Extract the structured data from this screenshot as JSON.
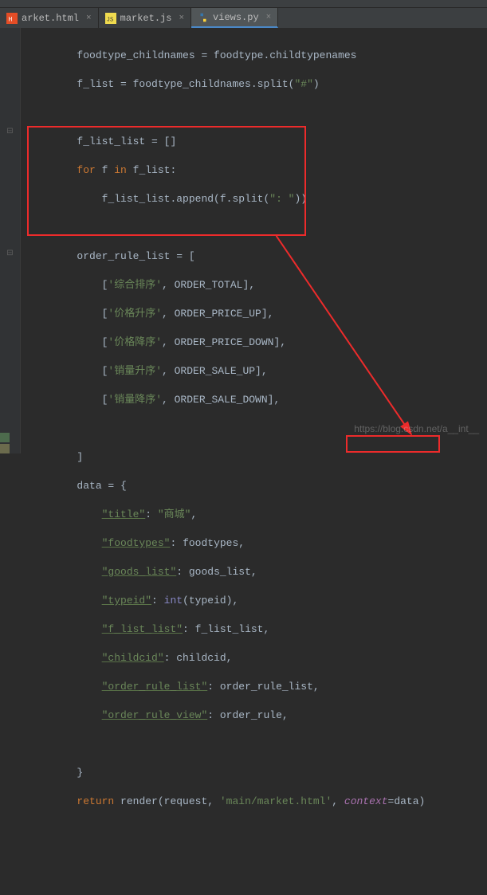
{
  "tabs": [
    {
      "label": "arket.html",
      "icon": "html-icon",
      "active": false
    },
    {
      "label": "market.js",
      "icon": "js-icon",
      "active": false
    },
    {
      "label": "views.py",
      "icon": "python-icon",
      "active": true
    }
  ],
  "code": {
    "l1_a": "foodtype_childnames = foodtype.childtypenames",
    "l2_a": "f_list = foodtype_childnames.split(",
    "l2_s": "\"#\"",
    "l2_b": ")",
    "l4_a": "f_list_list = []",
    "l5_kw": "for",
    "l5_a": " f ",
    "l5_kw2": "in",
    "l5_b": " f_list:",
    "l6_a": "f_list_list.append(f.split(",
    "l6_s": "\": \"",
    "l6_b": "))",
    "l8_a": "order_rule_list = [",
    "l9_s": "'综合排序'",
    "l9_c": ", ORDER_TOTAL],",
    "l10_s": "'价格升序'",
    "l10_c": ", ORDER_PRICE_UP],",
    "l11_s": "'价格降序'",
    "l11_c": ", ORDER_PRICE_DOWN],",
    "l12_s": "'销量升序'",
    "l12_c": ", ORDER_SALE_UP],",
    "l13_s": "'销量降序'",
    "l13_c": ", ORDER_SALE_DOWN],",
    "l15_a": "]",
    "l16_a": "data = {",
    "l17_k": "\"title\"",
    "l17_v": "\"商城\"",
    "l18_k": "\"foodtypes\"",
    "l18_v": "foodtypes,",
    "l19_k": "\"goods_list\"",
    "l19_v": "goods_list,",
    "l20_k": "\"typeid\"",
    "l20_v": "(typeid),",
    "l20_int": "int",
    "l21_k": "\"f_list_list\"",
    "l21_v": "f_list_list,",
    "l22_k": "\"childcid\"",
    "l22_v": "childcid,",
    "l23_k": "\"order_rule_list\"",
    "l23_v": "order_rule_list,",
    "l24_k": "\"order_rule_view\"",
    "l24_v": "order_rule,",
    "l26_a": "}",
    "l27_kw": "return",
    "l27_a": " render(request, ",
    "l27_s": "'main/market.html'",
    "l27_p": "context",
    "l27_b": "=data)"
  },
  "watermark": "https://blog.csdn.net/a__int__"
}
